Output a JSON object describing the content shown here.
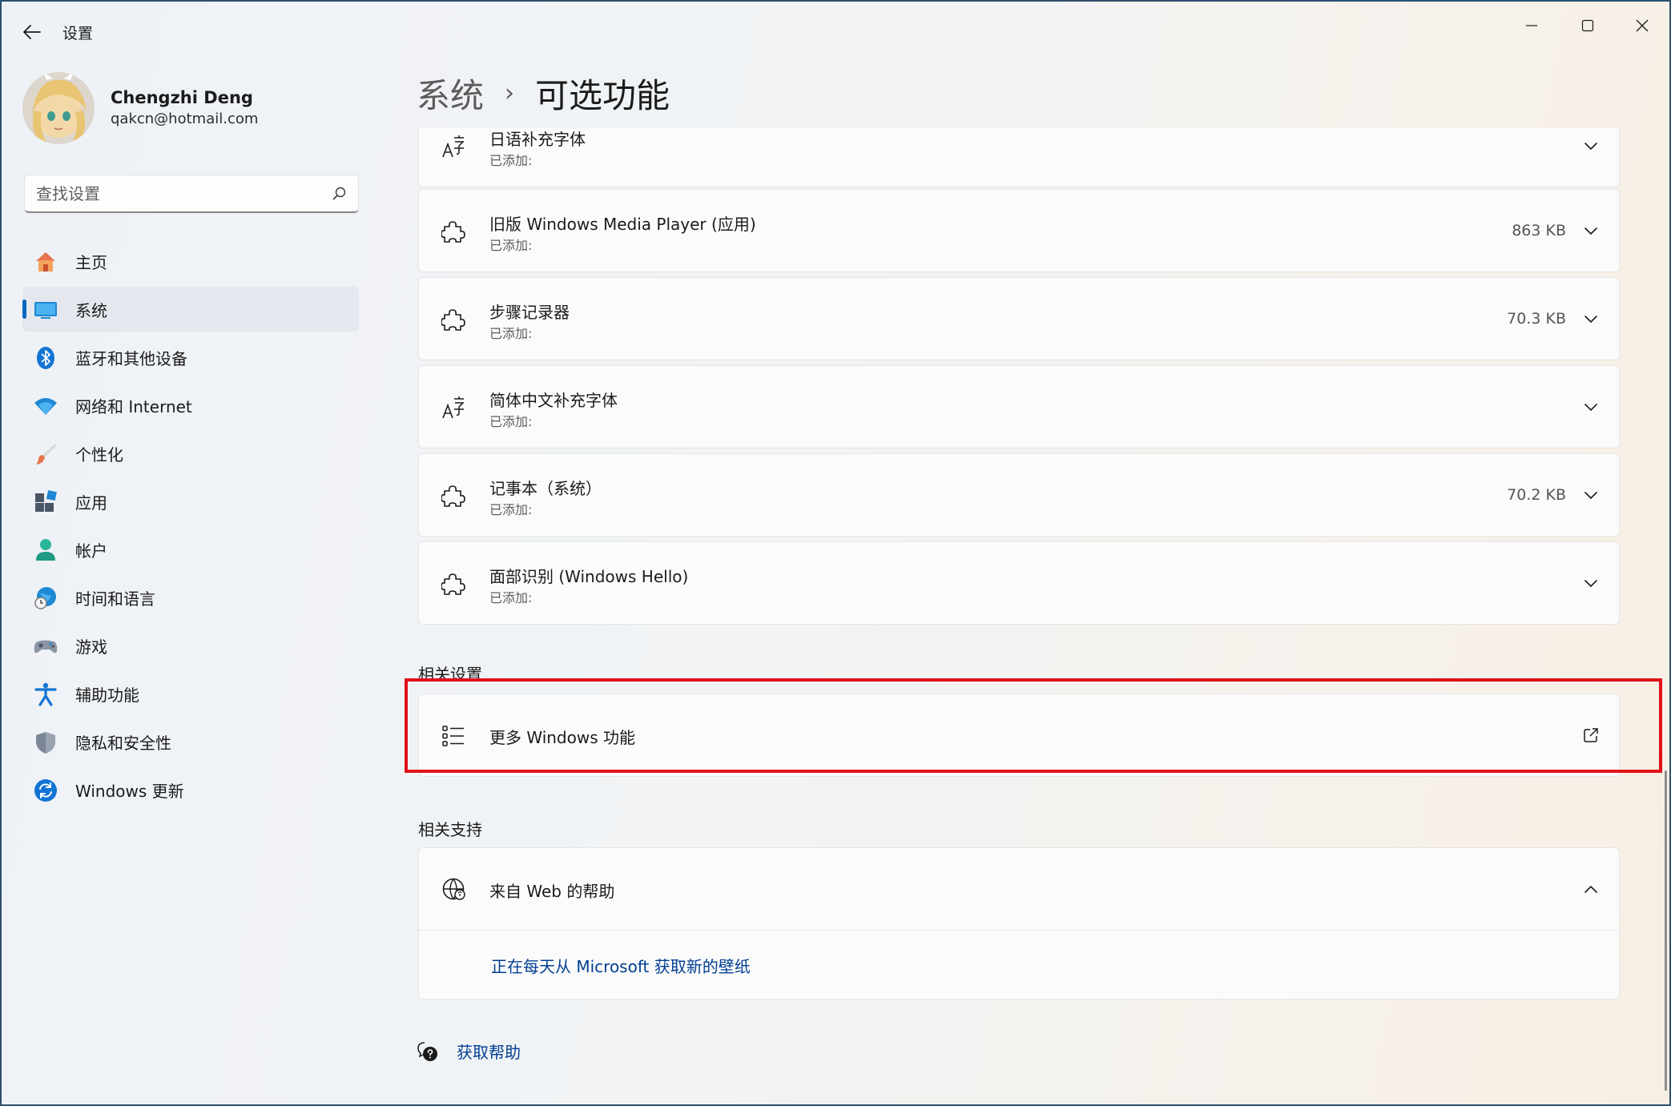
{
  "window": {
    "title": "设置"
  },
  "profile": {
    "name": "Chengzhi Deng",
    "email": "qakcn@hotmail.com"
  },
  "search": {
    "placeholder": "查找设置"
  },
  "sidebar": {
    "items": [
      {
        "label": "主页",
        "icon": "home-icon"
      },
      {
        "label": "系统",
        "icon": "system-icon",
        "active": true
      },
      {
        "label": "蓝牙和其他设备",
        "icon": "bluetooth-icon"
      },
      {
        "label": "网络和 Internet",
        "icon": "wifi-icon"
      },
      {
        "label": "个性化",
        "icon": "brush-icon"
      },
      {
        "label": "应用",
        "icon": "apps-icon"
      },
      {
        "label": "帐户",
        "icon": "account-icon"
      },
      {
        "label": "时间和语言",
        "icon": "globe-clock-icon"
      },
      {
        "label": "游戏",
        "icon": "gamepad-icon"
      },
      {
        "label": "辅助功能",
        "icon": "accessibility-icon"
      },
      {
        "label": "隐私和安全性",
        "icon": "shield-icon"
      },
      {
        "label": "Windows 更新",
        "icon": "update-icon"
      }
    ]
  },
  "breadcrumb": {
    "parent": "系统",
    "separator": "›",
    "current": "可选功能"
  },
  "features": [
    {
      "title": "日语补充字体",
      "status": "已添加:",
      "size": "",
      "icon": "font-icon"
    },
    {
      "title": "旧版 Windows Media Player (应用)",
      "status": "已添加:",
      "size": "863 KB",
      "icon": "puzzle-icon"
    },
    {
      "title": "步骤记录器",
      "status": "已添加:",
      "size": "70.3 KB",
      "icon": "puzzle-icon"
    },
    {
      "title": "简体中文补充字体",
      "status": "已添加:",
      "size": "",
      "icon": "font-icon"
    },
    {
      "title": "记事本（系统）",
      "status": "已添加:",
      "size": "70.2 KB",
      "icon": "puzzle-icon"
    },
    {
      "title": "面部识别 (Windows Hello)",
      "status": "已添加:",
      "size": "",
      "icon": "puzzle-icon"
    }
  ],
  "related_settings": {
    "title": "相关设置",
    "items": [
      {
        "label": "更多 Windows 功能",
        "icon": "list-icon",
        "action_icon": "external-link-icon"
      }
    ]
  },
  "related_support": {
    "title": "相关支持",
    "help_card": {
      "label": "来自 Web 的帮助",
      "icon": "globe-icon",
      "expanded": true,
      "links": [
        "正在每天从 Microsoft 获取新的壁纸"
      ]
    }
  },
  "footer": {
    "get_help": "获取帮助"
  },
  "colors": {
    "accent": "#0067c0",
    "highlight": "#e0101a",
    "link": "#003e92"
  }
}
